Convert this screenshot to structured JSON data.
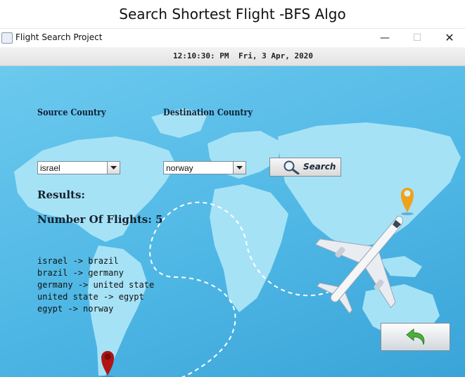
{
  "caption": "Search Shortest Flight -BFS Algo",
  "window": {
    "title": "Flight Search Project",
    "controls": {
      "minimize": "—",
      "maximize": "☐",
      "close": "✕"
    }
  },
  "status": {
    "time": "12:10:30: PM",
    "date": "Fri, 3 Apr, 2020"
  },
  "form": {
    "source_label": "Source Country",
    "source_value": "israel",
    "destination_label": "Destination Country",
    "destination_value": "norway",
    "search_label": "Search"
  },
  "results": {
    "title": "Results:",
    "count_text": "Number Of Flights: 5",
    "routes": [
      "israel -> brazil",
      "brazil -> germany",
      "germany -> united state",
      "united state -> egypt",
      "egypt -> norway"
    ]
  },
  "icons": {
    "app": "java-cup-icon",
    "search": "magnifier-icon",
    "back": "back-arrow-icon",
    "origin_pin": "map-pin-icon",
    "destination_pin": "map-pin-icon",
    "plane": "airplane-icon"
  },
  "colors": {
    "background": "#4fb7e5",
    "land": "#9fdff5",
    "origin_pin": "#b01414",
    "destination_pin": "#f0a21a",
    "back_arrow": "#4caf3a"
  }
}
